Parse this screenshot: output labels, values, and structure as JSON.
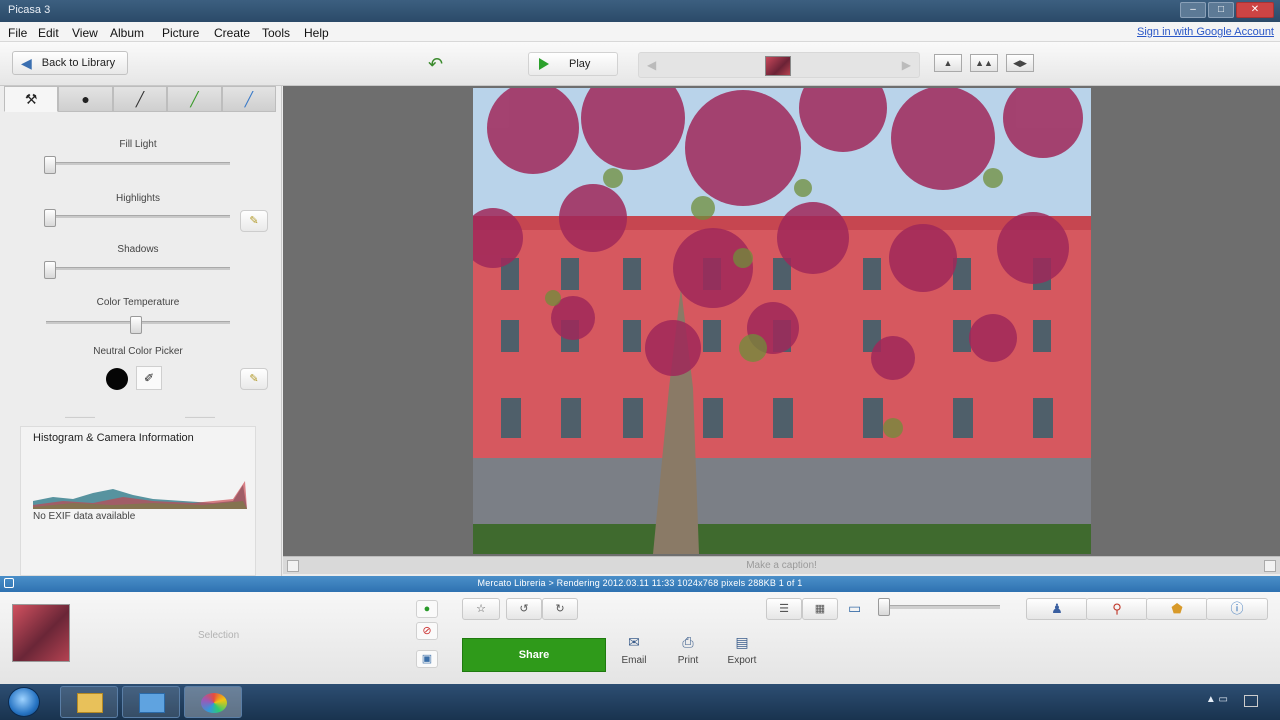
{
  "window": {
    "title": "Picasa 3"
  },
  "menu": {
    "items": [
      "File",
      "Edit",
      "View",
      "Album",
      "Picture",
      "Create",
      "Tools",
      "Help"
    ],
    "sign_in": "Sign in with Google Account"
  },
  "toolbar": {
    "back_label": "Back to Library",
    "play_label": "Play"
  },
  "edit_panel": {
    "sliders": [
      {
        "label": "Fill Light",
        "value": 0.0
      },
      {
        "label": "Highlights",
        "value": 0.0
      },
      {
        "label": "Shadows",
        "value": 0.0
      },
      {
        "label": "Color Temperature",
        "value": 0.5
      }
    ],
    "neutral_label": "Neutral Color Picker",
    "neutral_color": "#050505",
    "histogram_title": "Histogram & Camera Information",
    "histogram_note": "No EXIF data available"
  },
  "canvas": {
    "caption_placeholder": "Make a caption!"
  },
  "status": {
    "text": "Mercato Libreria > Rendering    2012.03.11 11:33    1024x768 pixels    288KB    1 of 1"
  },
  "tray": {
    "selection_label": "Selection",
    "share_label": "Share",
    "actions": [
      "Email",
      "Print",
      "Export"
    ]
  },
  "colors": {
    "accent_blue": "#2f72b1",
    "share_green": "#2f9a1a",
    "canvas_gray": "#6e6e6e"
  }
}
